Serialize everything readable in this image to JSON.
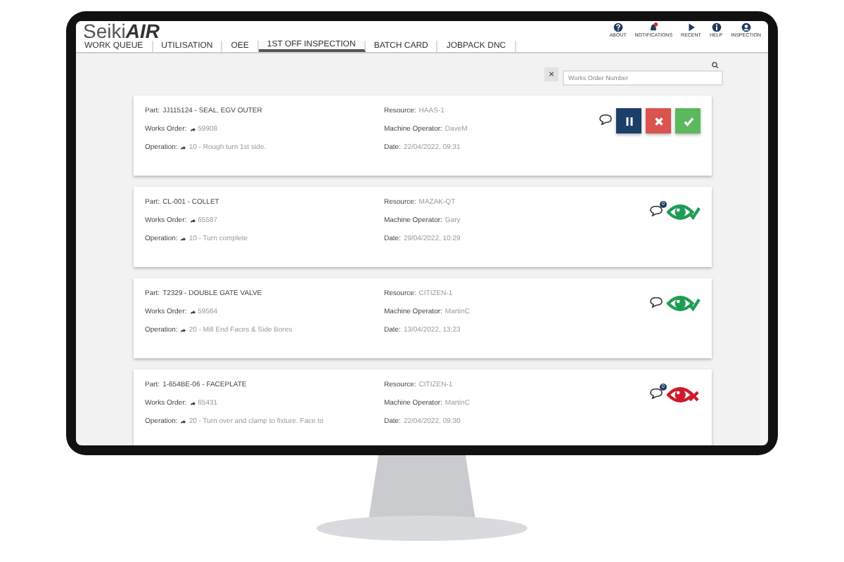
{
  "app": {
    "logo_light": "Seiki",
    "logo_bold": "AIR"
  },
  "header_icons": [
    {
      "kind": "about",
      "label": "ABOUT"
    },
    {
      "kind": "notifications",
      "label": "NOTIFICATIONS"
    },
    {
      "kind": "recent",
      "label": "RECENT"
    },
    {
      "kind": "help",
      "label": "HELP"
    },
    {
      "kind": "user",
      "label": "INSPECTION"
    }
  ],
  "tabs": [
    {
      "label": "WORK QUEUE",
      "selected": false
    },
    {
      "label": "UTILISATION",
      "selected": false
    },
    {
      "label": "OEE",
      "selected": false
    },
    {
      "label": "1ST OFF INSPECTION",
      "selected": true
    },
    {
      "label": "BATCH CARD",
      "selected": false
    },
    {
      "label": "JOBPACK DNC",
      "selected": false
    }
  ],
  "search": {
    "clear": "×",
    "placeholder": "Works Order Number"
  },
  "cards": [
    {
      "part_label": "Part:",
      "part": "JJ115124 -  SEAL, EGV OUTER",
      "works_order_label": "Works Order:",
      "works_order": "59908",
      "operation_label": "Operation:",
      "operation": "10 - Rough turn 1st side.",
      "resource_label": "Resource:",
      "resource": "HAAS-1",
      "operator_label": "Machine Operator:",
      "operator": "DaveM",
      "date_label": "Date:",
      "date": "22/04/2022, 09:31",
      "kind": "actions"
    },
    {
      "part_label": "Part:",
      "part": "CL-001 -  COLLET",
      "works_order_label": "Works Order:",
      "works_order": "65587",
      "operation_label": "Operation:",
      "operation": "10 - Turn complete",
      "resource_label": "Resource:",
      "resource": "MAZAK-QT",
      "operator_label": "Machine Operator:",
      "operator": "Gary",
      "date_label": "Date:",
      "date": "29/04/2022, 10:29",
      "comment_badge": "0",
      "kind": "passed"
    },
    {
      "part_label": "Part:",
      "part": "T2329 -  DOUBLE GATE VALVE",
      "works_order_label": "Works Order:",
      "works_order": "59564",
      "operation_label": "Operation:",
      "operation": "20 - Mill End Faces & Side Bores",
      "resource_label": "Resource:",
      "resource": "CITIZEN-1",
      "operator_label": "Machine Operator:",
      "operator": "MartinC",
      "date_label": "Date:",
      "date": "13/04/2022, 13:23",
      "kind": "passed"
    },
    {
      "part_label": "Part:",
      "part": "1-654BE-06 -  FACEPLATE",
      "works_order_label": "Works Order:",
      "works_order": "65431",
      "operation_label": "Operation:",
      "operation": "20 - Turn over and clamp to fixture. Face to",
      "resource_label": "Resource:",
      "resource": "CITIZEN-1",
      "operator_label": "Machine Operator:",
      "operator": "MartinC",
      "date_label": "Date:",
      "date": "22/04/2022, 09:30",
      "comment_badge": "0",
      "kind": "failed"
    }
  ]
}
